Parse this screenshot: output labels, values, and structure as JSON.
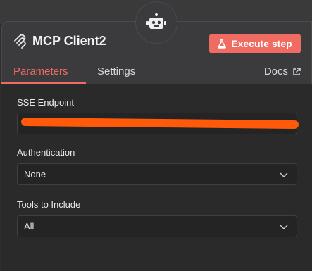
{
  "node": {
    "title": "MCP Client2",
    "execute_label": "Execute step"
  },
  "tabs": [
    {
      "label": "Parameters"
    },
    {
      "label": "Settings"
    }
  ],
  "docs_label": "Docs",
  "fields": {
    "sse_endpoint": {
      "label": "SSE Endpoint",
      "value": ""
    },
    "authentication": {
      "label": "Authentication",
      "value": "None"
    },
    "tools": {
      "label": "Tools to Include",
      "value": "All"
    }
  },
  "colors": {
    "accent": "#f06b62",
    "redaction": "#ff5a0a"
  },
  "icons": [
    "robot-icon",
    "mcp-icon",
    "flask-icon",
    "external-link-icon",
    "chevron-down-icon"
  ]
}
